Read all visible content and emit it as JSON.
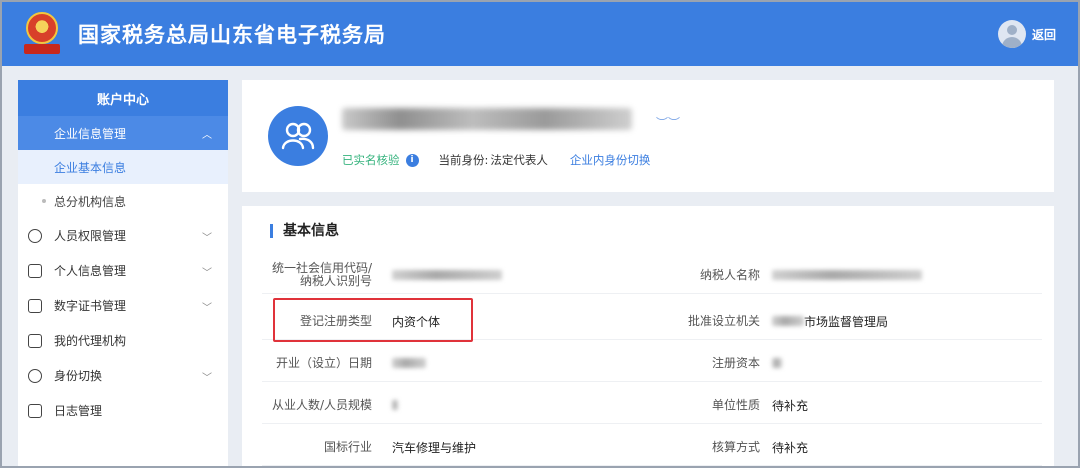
{
  "header": {
    "title": "国家税务总局山东省电子税务局",
    "back_label": "返回",
    "brand_color": "#3b7ee0"
  },
  "sidebar": {
    "title": "账户中心",
    "group": {
      "label": "企业信息管理",
      "expanded": true
    },
    "sub_items": [
      {
        "label": "企业基本信息",
        "active": true
      },
      {
        "label": "总分机构信息",
        "active": false
      }
    ],
    "items": [
      {
        "label": "人员权限管理",
        "icon": "user-shield-icon",
        "has_chevron": true
      },
      {
        "label": "个人信息管理",
        "icon": "id-card-icon",
        "has_chevron": true
      },
      {
        "label": "数字证书管理",
        "icon": "certificate-icon",
        "has_chevron": true
      },
      {
        "label": "我的代理机构",
        "icon": "agency-icon",
        "has_chevron": false
      },
      {
        "label": "身份切换",
        "icon": "switch-icon",
        "has_chevron": true
      },
      {
        "label": "日志管理",
        "icon": "log-icon",
        "has_chevron": false
      }
    ]
  },
  "profile": {
    "verified_label": "已实名核验",
    "identity_label": "当前身份:",
    "identity_value": "法定代表人",
    "switch_link": "企业内身份切换"
  },
  "basic_info": {
    "title": "基本信息",
    "rows": [
      {
        "left_label": "统一社会信用代码/纳税人识别号",
        "left_value": "",
        "right_label": "纳税人名称",
        "right_value": ""
      },
      {
        "left_label": "登记注册类型",
        "left_value": "内资个体",
        "right_label": "批准设立机关",
        "right_value": "市场监督管理局"
      },
      {
        "left_label": "开业（设立）日期",
        "left_value": "",
        "right_label": "注册资本",
        "right_value": ""
      },
      {
        "left_label": "从业人数/人员规模",
        "left_value": "",
        "right_label": "单位性质",
        "right_value": "待补充"
      },
      {
        "left_label": "国标行业",
        "left_value": "汽车修理与维护",
        "right_label": "核算方式",
        "right_value": "待补充"
      }
    ]
  }
}
